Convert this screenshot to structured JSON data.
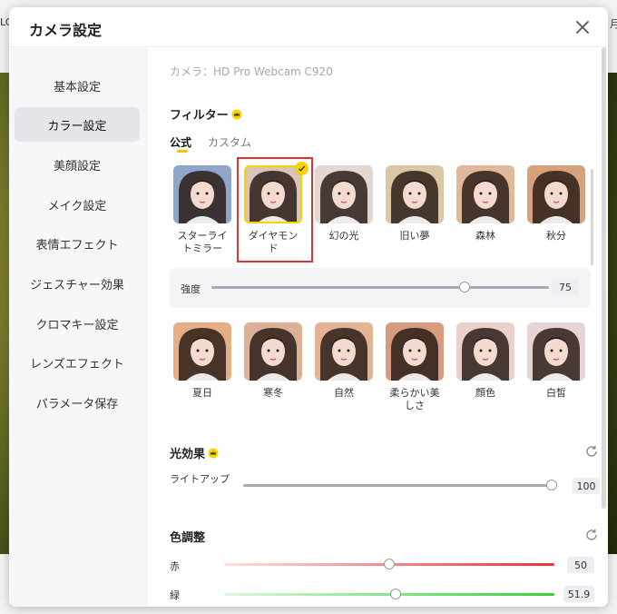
{
  "background": {
    "edge_left": "LO",
    "edge_right": "月"
  },
  "dialog": {
    "title": "カメラ設定",
    "camera_label": "カメラ：HD Pro Webcam C920"
  },
  "sidebar": {
    "items": [
      {
        "label": "基本設定",
        "active": false
      },
      {
        "label": "カラー設定",
        "active": true
      },
      {
        "label": "美顔設定",
        "active": false
      },
      {
        "label": "メイク設定",
        "active": false
      },
      {
        "label": "表情エフェクト",
        "active": false
      },
      {
        "label": "ジェスチャー効果",
        "active": false
      },
      {
        "label": "クロマキー設定",
        "active": false
      },
      {
        "label": "レンズエフェクト",
        "active": false
      },
      {
        "label": "パラメータ保存",
        "active": false
      }
    ]
  },
  "filter": {
    "title": "フィルター",
    "tabs": [
      {
        "label": "公式",
        "active": true
      },
      {
        "label": "カスタム",
        "active": false
      }
    ],
    "row1": [
      {
        "name": "スターライトミラー",
        "icon": "face-thumbnail",
        "tone": "#8fa6c8"
      },
      {
        "name": "ダイヤモンド",
        "icon": "face-thumbnail",
        "tone": "#d8c4b8",
        "selected": true
      },
      {
        "name": "幻の光",
        "icon": "face-thumbnail",
        "tone": "#e4d6d0"
      },
      {
        "name": "旧い夢",
        "icon": "face-thumbnail",
        "tone": "#d9c8a6"
      },
      {
        "name": "森林",
        "icon": "face-thumbnail",
        "tone": "#e2b89a"
      },
      {
        "name": "秋分",
        "icon": "face-thumbnail",
        "tone": "#d6a27c"
      }
    ],
    "strength": {
      "label": "強度",
      "value": "75",
      "level": 0.75
    },
    "row2": [
      {
        "name": "夏日",
        "icon": "face-thumbnail",
        "tone": "#e6ae86"
      },
      {
        "name": "寒冬",
        "icon": "face-thumbnail",
        "tone": "#dcb198"
      },
      {
        "name": "自然",
        "icon": "face-thumbnail",
        "tone": "#e4b394"
      },
      {
        "name": "柔らかい美しさ",
        "icon": "face-thumbnail",
        "tone": "#d59c80"
      },
      {
        "name": "顔色",
        "icon": "face-thumbnail",
        "tone": "#ecd0cc"
      },
      {
        "name": "白皙",
        "icon": "face-thumbnail",
        "tone": "#e8d4d4"
      }
    ]
  },
  "light_effect": {
    "title": "光効果",
    "lightup": {
      "label": "ライトアップ",
      "value": "100",
      "level": 1.0
    }
  },
  "color_adjust": {
    "title": "色調整",
    "red": {
      "label": "赤",
      "value": "50",
      "level": 0.5
    },
    "green": {
      "label": "緑",
      "value": "51.9",
      "level": 0.519
    }
  },
  "colors": {
    "accent": "#f5d400",
    "red_track": "#e8323a",
    "green_track": "#36d23a",
    "selection_box": "#e03030"
  }
}
